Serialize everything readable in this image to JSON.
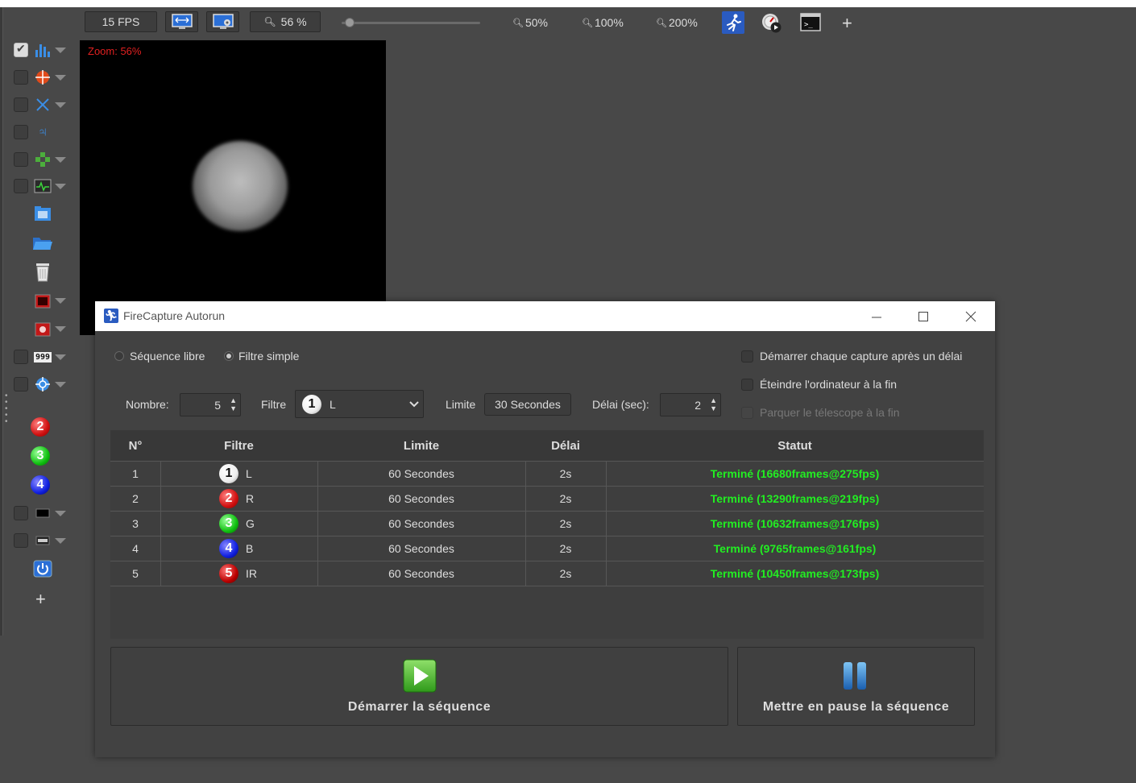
{
  "toolbar": {
    "fps": "15 FPS",
    "zoom_value": "56 %",
    "zoom_slider_percent": 56,
    "zoom_presets": [
      "50%",
      "100%",
      "200%"
    ],
    "icons": [
      "fit-screen-icon",
      "screen-settings-icon",
      "autorun-icon",
      "capture-speed-icon",
      "terminal-icon",
      "add-icon"
    ],
    "add_glyph": "+"
  },
  "preview": {
    "zoom_label": "Zoom: 56%"
  },
  "left_tools": {
    "filter_numbers": [
      "2",
      "3",
      "4"
    ],
    "counter_icon_text": "999",
    "jupiter_glyph": "♃",
    "add_glyph": "+"
  },
  "dialog": {
    "title": "FireCapture Autorun",
    "mode_options": [
      "Séquence libre",
      "Filtre simple"
    ],
    "selected_mode": "Filtre simple",
    "options": [
      {
        "label": "Démarrer chaque capture après un délai",
        "checked": false,
        "enabled": true
      },
      {
        "label": "Éteindre l'ordinateur à la fin",
        "checked": false,
        "enabled": true
      },
      {
        "label": "Parquer le télescope à la fin",
        "checked": false,
        "enabled": false
      }
    ],
    "nombre_label": "Nombre:",
    "nombre_value": "5",
    "filtre_label": "Filtre",
    "filtre_number": "1",
    "filtre_value": "L",
    "limite_label": "Limite",
    "limite_value": "30 Secondes",
    "delai_label": "Délai (sec):",
    "delai_value": "2",
    "table": {
      "headers": [
        "N°",
        "Filtre",
        "Limite",
        "Délai",
        "Statut"
      ],
      "rows": [
        {
          "n": "1",
          "filter_num": "1",
          "filter": "L",
          "limit": "60 Secondes",
          "delay": "2s",
          "status": "Terminé  (16680frames@275fps)",
          "color": "white"
        },
        {
          "n": "2",
          "filter_num": "2",
          "filter": "R",
          "limit": "60 Secondes",
          "delay": "2s",
          "status": "Terminé  (13290frames@219fps)",
          "color": "red"
        },
        {
          "n": "3",
          "filter_num": "3",
          "filter": "G",
          "limit": "60 Secondes",
          "delay": "2s",
          "status": "Terminé  (10632frames@176fps)",
          "color": "green"
        },
        {
          "n": "4",
          "filter_num": "4",
          "filter": "B",
          "limit": "60 Secondes",
          "delay": "2s",
          "status": "Terminé  (9765frames@161fps)",
          "color": "blue"
        },
        {
          "n": "5",
          "filter_num": "5",
          "filter": "IR",
          "limit": "60 Secondes",
          "delay": "2s",
          "status": "Terminé  (10450frames@173fps)",
          "color": "dred"
        }
      ]
    },
    "start_button": "Démarrer la séquence",
    "pause_button": "Mettre en pause la séquence"
  }
}
